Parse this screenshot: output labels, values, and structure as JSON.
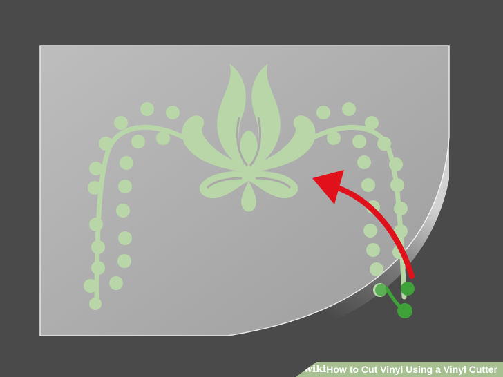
{
  "colors": {
    "background": "#4a4a4a",
    "sheet": "#a9a9a9",
    "pattern_faded": "#b9d6a9",
    "pattern_peeled": "#3fa13a",
    "arrow": "#e0111b",
    "watermark_bg": "#a7c091"
  },
  "watermark": {
    "brand": "wiki",
    "how": "How",
    "rest": "to Cut Vinyl Using a Vinyl Cutter"
  },
  "icons": {
    "arrow": "curved-arrow-icon",
    "ornament": "lotus-ornament"
  }
}
